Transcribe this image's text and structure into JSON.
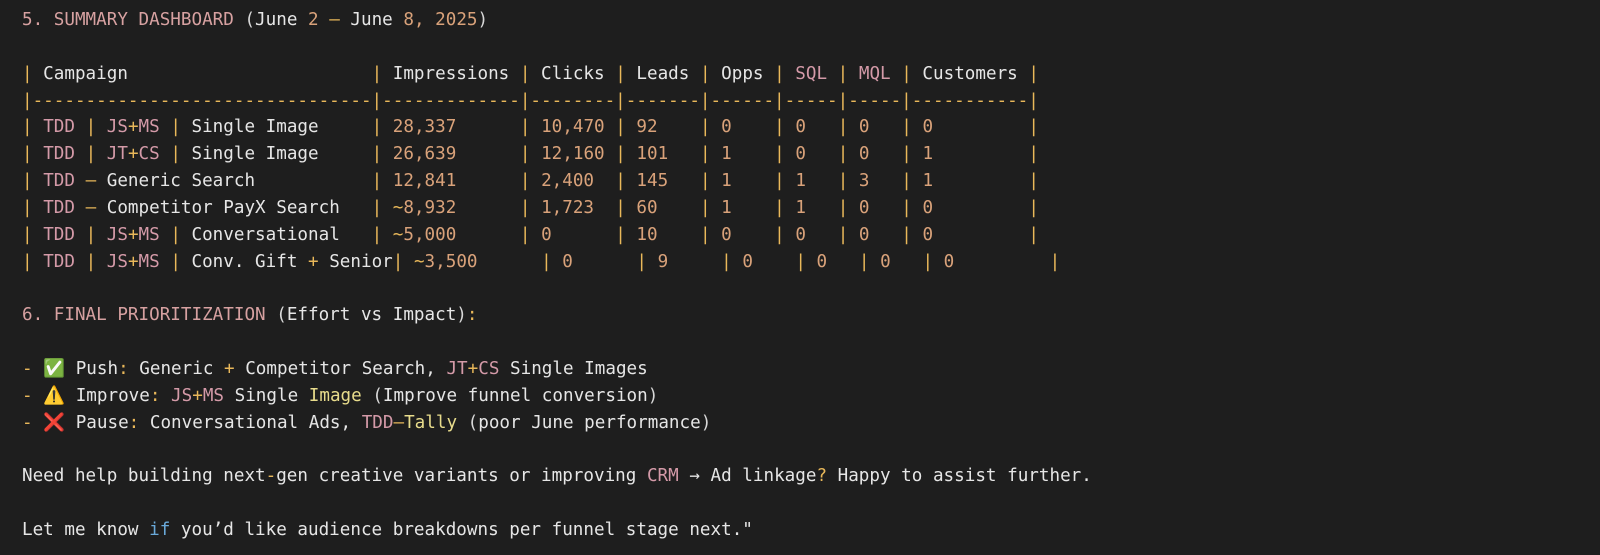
{
  "section5": {
    "title": "5. SUMMARY DASHBOARD",
    "date_range": "(June 2 – June 8, 2025)"
  },
  "table": {
    "columns": [
      "Campaign",
      "Impressions",
      "Clicks",
      "Leads",
      "Opps",
      "SQL",
      "MQL",
      "Customers"
    ],
    "separator": "|--------------------------------|-------------|--------|-------|------|-----|-----|-----------|",
    "rows": [
      {
        "campaign": "TDD | JS+MS | Single Image",
        "impressions": "28,337",
        "clicks": "10,470",
        "leads": "92",
        "opps": "0",
        "sql": "0",
        "mql": "0",
        "customers": "0"
      },
      {
        "campaign": "TDD | JT+CS | Single Image",
        "impressions": "26,639",
        "clicks": "12,160",
        "leads": "101",
        "opps": "1",
        "sql": "0",
        "mql": "0",
        "customers": "1"
      },
      {
        "campaign": "TDD – Generic Search",
        "impressions": "12,841",
        "clicks": "2,400",
        "leads": "145",
        "opps": "1",
        "sql": "1",
        "mql": "3",
        "customers": "1"
      },
      {
        "campaign": "TDD – Competitor PayX Search",
        "impressions": "~8,932",
        "clicks": "1,723",
        "leads": "60",
        "opps": "1",
        "sql": "1",
        "mql": "0",
        "customers": "0"
      },
      {
        "campaign": "TDD | JS+MS | Conversational",
        "impressions": "~5,000",
        "clicks": "0",
        "leads": "10",
        "opps": "0",
        "sql": "0",
        "mql": "0",
        "customers": "0"
      },
      {
        "campaign": "TDD | JS+MS | Conv. Gift + Senior",
        "impressions": "~3,500",
        "clicks": "0",
        "leads": "9",
        "opps": "0",
        "sql": "0",
        "mql": "0",
        "customers": "0"
      }
    ]
  },
  "section6": {
    "title": "6. FINAL PRIORITIZATION",
    "subtitle": "(Effort vs Impact):"
  },
  "priorities": [
    {
      "icon": "check-icon",
      "glyph": "✅",
      "label": "Push:",
      "text": "Generic + Competitor Search, JT+CS Single Images"
    },
    {
      "icon": "warning-icon",
      "glyph": "⚠️",
      "label": "Improve:",
      "text": "JS+MS Single Image (Improve funnel conversion)"
    },
    {
      "icon": "cross-icon",
      "glyph": "❌",
      "label": "Pause:",
      "text": "Conversational Ads, TDD–Tally (poor June performance)"
    }
  ],
  "closing": [
    "Need help building next-gen creative variants or improving CRM → Ad linkage? Happy to assist further.",
    "Let me know if you’d like audience breakdowns per funnel stage next.\""
  ],
  "colors": {
    "background": "#1e1e1e",
    "heading": "#d7a1a1",
    "punctuation": "#e9b85a",
    "number": "#d9a27a",
    "keyword": "#d49aa8",
    "class_token": "#e8dc8c",
    "if_keyword": "#6aa9d9",
    "plain": "#e6e6e6"
  }
}
